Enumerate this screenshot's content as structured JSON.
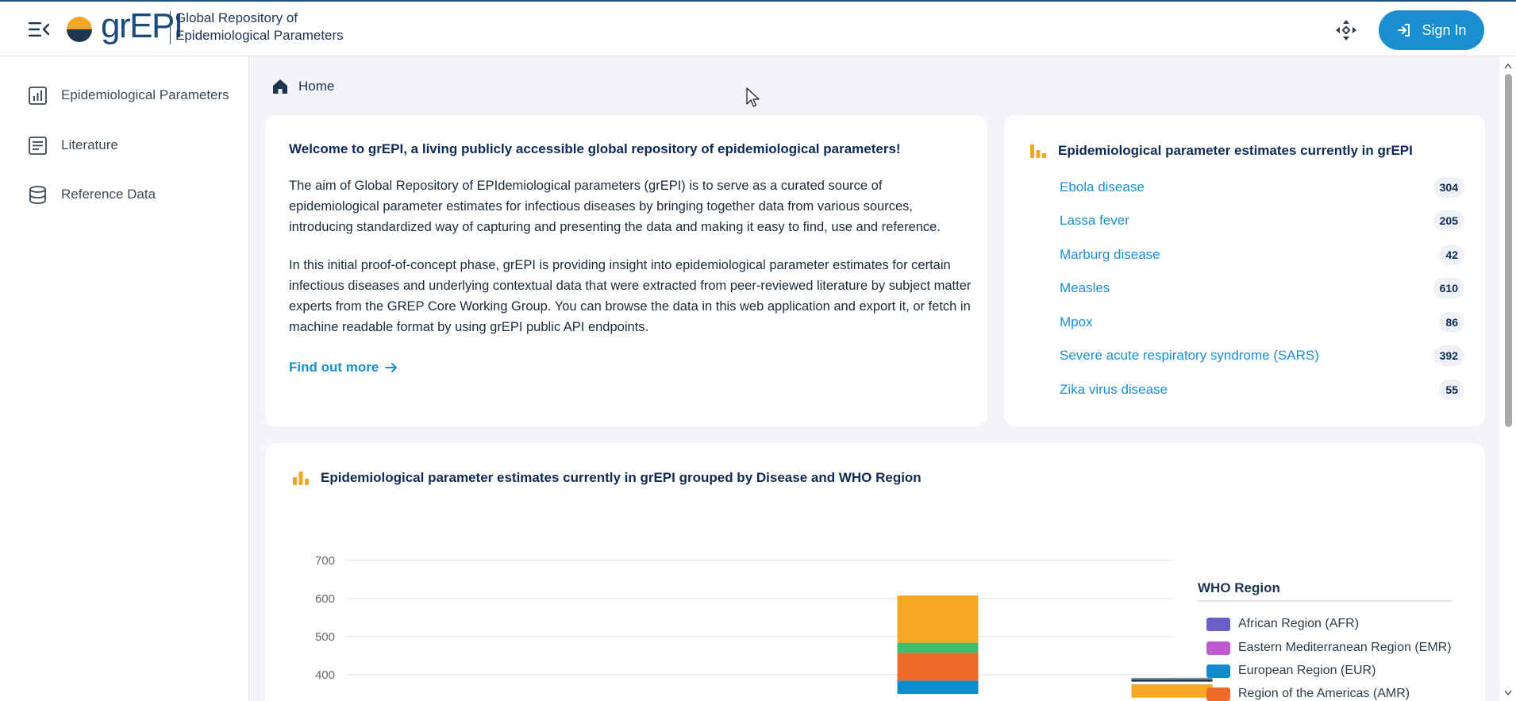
{
  "header": {
    "logo_word": "grEPI",
    "logo_subtitle_line1": "Global Repository of",
    "logo_subtitle_line2": "Epidemiological Parameters",
    "sign_in_label": "Sign In",
    "brand_color": "#1d4c7a",
    "accent_color": "#1a8fd0"
  },
  "sidebar": {
    "items": [
      {
        "label": "Epidemiological Parameters",
        "icon": "bar-chart-icon"
      },
      {
        "label": "Literature",
        "icon": "document-icon"
      },
      {
        "label": "Reference Data",
        "icon": "database-icon"
      }
    ]
  },
  "breadcrumb": {
    "home_label": "Home"
  },
  "welcome": {
    "title": "Welcome to grEPI, a living publicly accessible global repository of epidemiological parameters!",
    "para1": "The aim of Global Repository of EPIdemiological parameters (grEPI) is to serve as a curated source of epidemiological parameter estimates for infectious diseases by bringing together data from various sources, introducing standardized way of capturing and presenting the data and making it easy to find, use and reference.",
    "para2": "In this initial proof-of-concept phase, grEPI is providing insight into epidemiological parameter estimates for certain infectious diseases and underlying contextual data that were extracted from peer-reviewed literature by subject matter experts from the GREP Core Working Group. You can browse the data in this web application and export it, or fetch in machine readable format by using grEPI public API endpoints.",
    "find_out_more": "Find out more"
  },
  "stats": {
    "title": "Epidemiological parameter estimates currently in grEPI",
    "diseases": [
      {
        "name": "Ebola disease",
        "count": "304"
      },
      {
        "name": "Lassa fever",
        "count": "205"
      },
      {
        "name": "Marburg disease",
        "count": "42"
      },
      {
        "name": "Measles",
        "count": "610"
      },
      {
        "name": "Mpox",
        "count": "86"
      },
      {
        "name": "Severe acute respiratory syndrome (SARS)",
        "count": "392"
      },
      {
        "name": "Zika virus disease",
        "count": "55"
      }
    ]
  },
  "chart_section": {
    "title": "Epidemiological parameter estimates currently in grEPI grouped by Disease and WHO Region",
    "legend_title": "WHO Region",
    "legend": [
      {
        "label": "African Region (AFR)",
        "color": "#6a5fc9"
      },
      {
        "label": "Eastern Mediterranean Region (EMR)",
        "color": "#c05ad0"
      },
      {
        "label": "European Region (EUR)",
        "color": "#0f8ccc"
      },
      {
        "label": "Region of the Americas (AMR)",
        "color": "#f06a2c"
      }
    ]
  },
  "chart_data": {
    "type": "bar",
    "stacked": true,
    "yticks": [
      "700",
      "600",
      "500",
      "400"
    ],
    "ylim": [
      0,
      700
    ],
    "grid": true,
    "legend_placement": "right",
    "visible_bars": [
      {
        "slot": 3,
        "segments": [
          {
            "from": 350,
            "to": 385,
            "color": "#0f8ccc"
          },
          {
            "from": 385,
            "to": 458,
            "color": "#f06a2c"
          },
          {
            "from": 458,
            "to": 484,
            "color": "#3cbf6c"
          },
          {
            "from": 484,
            "to": 608,
            "color": "#f5a623"
          }
        ]
      },
      {
        "slot": 4,
        "segments": [
          {
            "from": 340,
            "to": 375,
            "color": "#f5a623"
          },
          {
            "from": 375,
            "to": 382,
            "color": "#ffffff"
          },
          {
            "from": 382,
            "to": 388,
            "color": "#1d3550"
          },
          {
            "from": 388,
            "to": 392,
            "color": "#7c8ca0"
          }
        ]
      }
    ]
  }
}
